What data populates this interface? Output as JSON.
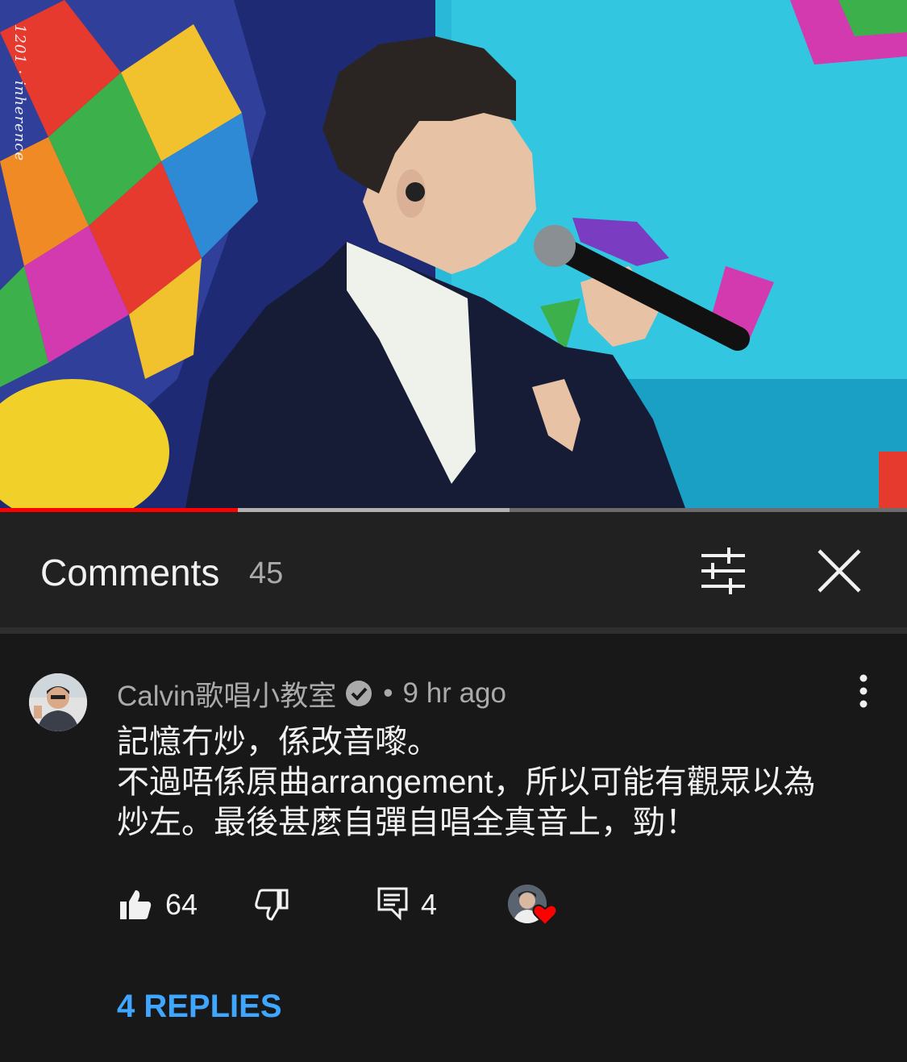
{
  "video": {
    "watermark": "1201 · inherence",
    "progress": {
      "played_fraction": 0.262,
      "buffered_fraction": 0.562
    }
  },
  "comments_panel": {
    "title": "Comments",
    "count": "45"
  },
  "comment": {
    "author": "Calvin歌唱小教室",
    "separator": "•",
    "time": "9 hr ago",
    "body_lines": [
      "記憶冇炒，係改音嚟。",
      "不過唔係原曲arrangement，所以可能有觀眾以為",
      "炒左。最後甚麼自彈自唱全真音上，勁！"
    ],
    "like_count": "64",
    "reply_count": "4",
    "replies_link": "4 REPLIES"
  },
  "colors": {
    "background": "#181818",
    "header": "#212121",
    "accent_link": "#3ea6ff",
    "progress_played": "#ff0000",
    "heart": "#ff0000",
    "secondary_text": "#aaaaaa"
  }
}
